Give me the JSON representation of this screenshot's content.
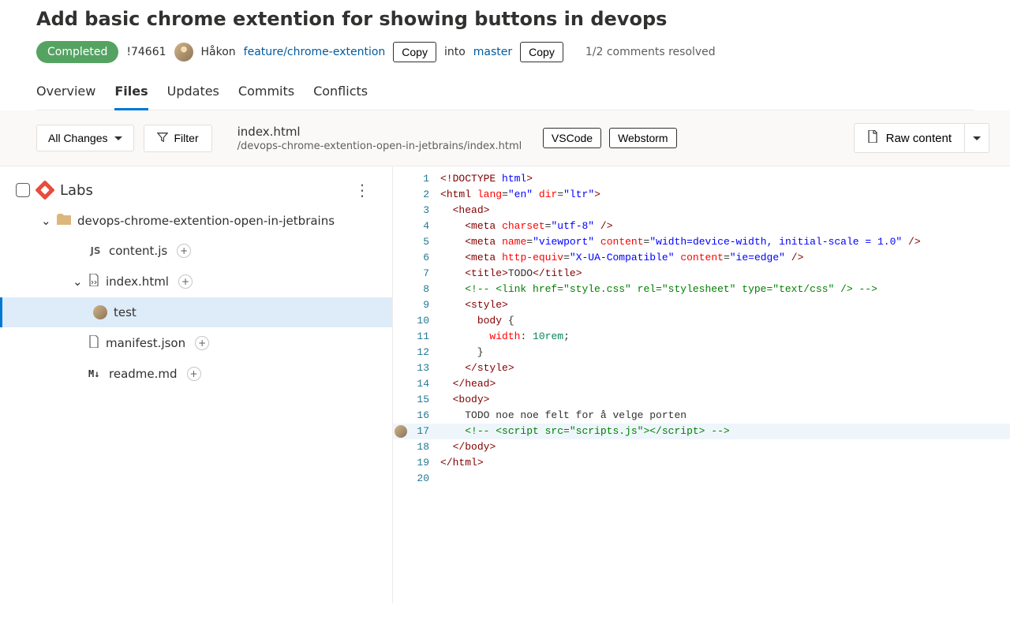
{
  "header": {
    "title": "Add basic chrome extention for showing buttons in devops",
    "status": "Completed",
    "pr_id": "!74661",
    "author": "Håkon",
    "source_branch": "feature/chrome-extention",
    "copy_label": "Copy",
    "into_label": "into",
    "target_branch": "master",
    "comments_resolved": "1/2 comments resolved"
  },
  "tabs": {
    "overview": "Overview",
    "files": "Files",
    "updates": "Updates",
    "commits": "Commits",
    "conflicts": "Conflicts"
  },
  "toolbar": {
    "all_changes": "All Changes",
    "filter": "Filter",
    "file_name": "index.html",
    "file_path": "/devops-chrome-extention-open-in-jetbrains/index.html",
    "open_vscode": "VSCode",
    "open_webstorm": "Webstorm",
    "raw_content": "Raw content"
  },
  "tree": {
    "root": "Labs",
    "folder": "devops-chrome-extention-open-in-jetbrains",
    "files": {
      "content_js": "content.js",
      "index_html": "index.html",
      "manifest_json": "manifest.json",
      "readme_md": "readme.md"
    },
    "comment_label": "test"
  },
  "code": {
    "lines": [
      {
        "n": 1,
        "html": "<span class='t-gt'>&lt;!</span><span class='t-tag'>DOCTYPE</span> <span class='t-doctype'>html</span><span class='t-gt'>&gt;</span>"
      },
      {
        "n": 2,
        "html": "<span class='t-gt'>&lt;</span><span class='t-tag'>html</span> <span class='t-attr'>lang</span>=<span class='t-str'>\"en\"</span> <span class='t-attr'>dir</span>=<span class='t-str'>\"ltr\"</span><span class='t-gt'>&gt;</span>"
      },
      {
        "n": 3,
        "html": "  <span class='t-gt'>&lt;</span><span class='t-tag'>head</span><span class='t-gt'>&gt;</span>"
      },
      {
        "n": 4,
        "html": "    <span class='t-gt'>&lt;</span><span class='t-tag'>meta</span> <span class='t-attr'>charset</span>=<span class='t-str'>\"utf-8\"</span> <span class='t-gt'>/&gt;</span>"
      },
      {
        "n": 5,
        "html": "    <span class='t-gt'>&lt;</span><span class='t-tag'>meta</span> <span class='t-attr'>name</span>=<span class='t-str'>\"viewport\"</span> <span class='t-attr'>content</span>=<span class='t-str'>\"width=device-width, initial-scale = 1.0\"</span> <span class='t-gt'>/&gt;</span>"
      },
      {
        "n": 6,
        "html": "    <span class='t-gt'>&lt;</span><span class='t-tag'>meta</span> <span class='t-attr'>http-equiv</span>=<span class='t-str'>\"X-UA-Compatible\"</span> <span class='t-attr'>content</span>=<span class='t-str'>\"ie=edge\"</span> <span class='t-gt'>/&gt;</span>"
      },
      {
        "n": 7,
        "html": "    <span class='t-gt'>&lt;</span><span class='t-tag'>title</span><span class='t-gt'>&gt;</span><span class='t-text'>TODO</span><span class='t-gt'>&lt;/</span><span class='t-tag'>title</span><span class='t-gt'>&gt;</span>"
      },
      {
        "n": 8,
        "html": "    <span class='t-comment'>&lt;!-- &lt;link href=\"style.css\" rel=\"stylesheet\" type=\"text/css\" /&gt; --&gt;</span>"
      },
      {
        "n": 9,
        "html": "    <span class='t-gt'>&lt;</span><span class='t-tag'>style</span><span class='t-gt'>&gt;</span>"
      },
      {
        "n": 10,
        "html": "      <span class='t-sel'>body</span> {"
      },
      {
        "n": 11,
        "html": "        <span class='t-prop'>width</span>: <span class='t-num'>10rem</span>;"
      },
      {
        "n": 12,
        "html": "      }"
      },
      {
        "n": 13,
        "html": "    <span class='t-gt'>&lt;/</span><span class='t-tag'>style</span><span class='t-gt'>&gt;</span>"
      },
      {
        "n": 14,
        "html": "  <span class='t-gt'>&lt;/</span><span class='t-tag'>head</span><span class='t-gt'>&gt;</span>"
      },
      {
        "n": 15,
        "html": "  <span class='t-gt'>&lt;</span><span class='t-tag'>body</span><span class='t-gt'>&gt;</span>"
      },
      {
        "n": 16,
        "html": "    <span class='t-text'>TODO noe noe felt for å velge porten</span>"
      },
      {
        "n": 17,
        "html": "    <span class='t-comment'>&lt;!-- &lt;script src=\"scripts.js\"&gt;&lt;/script&gt; --&gt;</span>",
        "marked": true
      },
      {
        "n": 18,
        "html": "  <span class='t-gt'>&lt;/</span><span class='t-tag'>body</span><span class='t-gt'>&gt;</span>"
      },
      {
        "n": 19,
        "html": "<span class='t-gt'>&lt;/</span><span class='t-tag'>html</span><span class='t-gt'>&gt;</span>"
      },
      {
        "n": 20,
        "html": ""
      }
    ]
  }
}
